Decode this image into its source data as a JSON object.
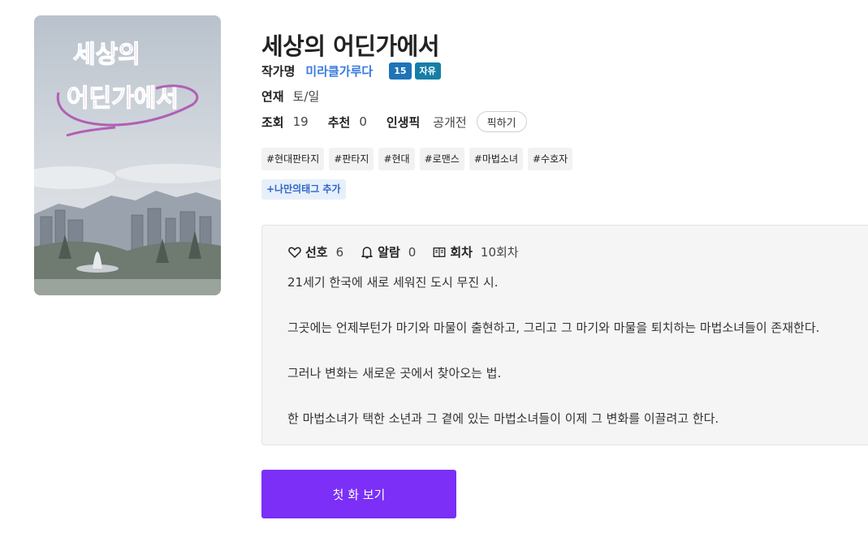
{
  "cover": {
    "title_line1": "세상의",
    "title_line2": "어딘가에서"
  },
  "work": {
    "title": "세상의 어딘가에서",
    "author_label": "작가명",
    "author_name": "미라클가루다",
    "age_badge": "15",
    "free_badge": "자유",
    "serial_label": "연재",
    "serial_days": "토/일",
    "views_label": "조회",
    "views": "19",
    "recommend_label": "추천",
    "recommend": "0",
    "life_pick_label": "인생픽",
    "life_pick_value": "공개전",
    "pick_button": "픽하기"
  },
  "tags": [
    "#현대판타지",
    "#판타지",
    "#현대",
    "#로맨스",
    "#마법소녀",
    "#수호자"
  ],
  "add_tag_label": "+나만의태그 추가",
  "stats": {
    "favorite_label": "선호",
    "favorite": "6",
    "alarm_label": "알람",
    "alarm": "0",
    "episodes_label": "회차",
    "episodes": "10회차"
  },
  "synopsis": [
    "21세기 한국에 새로 세워진 도시 무진 시.",
    "그곳에는 언제부턴가 마기와 마물이 출현하고, 그리고 그 마기와 마물을 퇴치하는 마법소녀들이 존재한다.",
    "그러나 변화는 새로운 곳에서 찾아오는 법.",
    "한 마법소녀가 택한 소년과 그 곁에 있는 마법소녀들이 이제 그 변화를 이끌려고 한다."
  ],
  "first_episode_button": "첫 화 보기",
  "colors": {
    "accent_button": "#7b2ff7",
    "author_link": "#3a7be0",
    "age_badge": "#1f73b7",
    "free_badge": "#167ea6"
  },
  "icons": {
    "favorite": "heart-icon",
    "alarm": "bell-icon",
    "episodes": "book-icon"
  }
}
